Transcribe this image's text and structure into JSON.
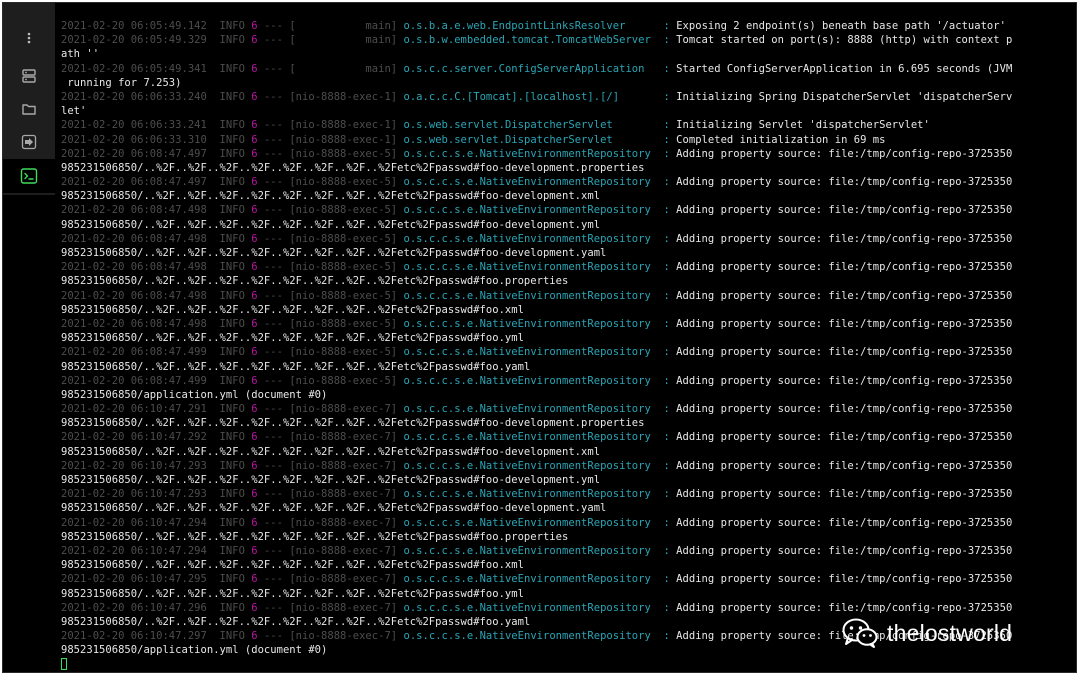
{
  "sidebar": {
    "items": [
      {
        "name": "more-options-icon"
      },
      {
        "name": "server-icon"
      },
      {
        "name": "folder-icon"
      },
      {
        "name": "forward-icon"
      },
      {
        "name": "terminal-icon"
      }
    ]
  },
  "terminal": {
    "lines": [
      "2021-02-20 06:05:49.142  INFO 6 --- [           main] o.s.b.a.e.web.EndpointLinksResolver      : Exposing 2 endpoint(s) beneath base path '/actuator'",
      "2021-02-20 06:05:49.329  INFO 6 --- [           main] o.s.b.w.embedded.tomcat.TomcatWebServer  : Tomcat started on port(s): 8888 (http) with context p",
      "ath ''",
      "2021-02-20 06:05:49.341  INFO 6 --- [           main] o.s.c.c.server.ConfigServerApplication   : Started ConfigServerApplication in 6.695 seconds (JVM",
      " running for 7.253)",
      "2021-02-20 06:06:33.240  INFO 6 --- [nio-8888-exec-1] o.a.c.c.C.[Tomcat].[localhost].[/]       : Initializing Spring DispatcherServlet 'dispatcherServ",
      "let'",
      "2021-02-20 06:06:33.241  INFO 6 --- [nio-8888-exec-1] o.s.web.servlet.DispatcherServlet        : Initializing Servlet 'dispatcherServlet'",
      "2021-02-20 06:06:33.310  INFO 6 --- [nio-8888-exec-1] o.s.web.servlet.DispatcherServlet        : Completed initialization in 69 ms",
      "2021-02-20 06:08:47.497  INFO 6 --- [nio-8888-exec-5] o.s.c.c.s.e.NativeEnvironmentRepository  : Adding property source: file:/tmp/config-repo-3725350",
      "985231506850/..%2F..%2F..%2F..%2F..%2F..%2F..%2F..%2Fetc%2Fpasswd#foo-development.properties",
      "2021-02-20 06:08:47.497  INFO 6 --- [nio-8888-exec-5] o.s.c.c.s.e.NativeEnvironmentRepository  : Adding property source: file:/tmp/config-repo-3725350",
      "985231506850/..%2F..%2F..%2F..%2F..%2F..%2F..%2F..%2Fetc%2Fpasswd#foo-development.xml",
      "2021-02-20 06:08:47.498  INFO 6 --- [nio-8888-exec-5] o.s.c.c.s.e.NativeEnvironmentRepository  : Adding property source: file:/tmp/config-repo-3725350",
      "985231506850/..%2F..%2F..%2F..%2F..%2F..%2F..%2F..%2Fetc%2Fpasswd#foo-development.yml",
      "2021-02-20 06:08:47.498  INFO 6 --- [nio-8888-exec-5] o.s.c.c.s.e.NativeEnvironmentRepository  : Adding property source: file:/tmp/config-repo-3725350",
      "985231506850/..%2F..%2F..%2F..%2F..%2F..%2F..%2F..%2Fetc%2Fpasswd#foo-development.yaml",
      "2021-02-20 06:08:47.498  INFO 6 --- [nio-8888-exec-5] o.s.c.c.s.e.NativeEnvironmentRepository  : Adding property source: file:/tmp/config-repo-3725350",
      "985231506850/..%2F..%2F..%2F..%2F..%2F..%2F..%2F..%2Fetc%2Fpasswd#foo.properties",
      "2021-02-20 06:08:47.498  INFO 6 --- [nio-8888-exec-5] o.s.c.c.s.e.NativeEnvironmentRepository  : Adding property source: file:/tmp/config-repo-3725350",
      "985231506850/..%2F..%2F..%2F..%2F..%2F..%2F..%2F..%2Fetc%2Fpasswd#foo.xml",
      "2021-02-20 06:08:47.498  INFO 6 --- [nio-8888-exec-5] o.s.c.c.s.e.NativeEnvironmentRepository  : Adding property source: file:/tmp/config-repo-3725350",
      "985231506850/..%2F..%2F..%2F..%2F..%2F..%2F..%2F..%2Fetc%2Fpasswd#foo.yml",
      "2021-02-20 06:08:47.499  INFO 6 --- [nio-8888-exec-5] o.s.c.c.s.e.NativeEnvironmentRepository  : Adding property source: file:/tmp/config-repo-3725350",
      "985231506850/..%2F..%2F..%2F..%2F..%2F..%2F..%2F..%2Fetc%2Fpasswd#foo.yaml",
      "2021-02-20 06:08:47.499  INFO 6 --- [nio-8888-exec-5] o.s.c.c.s.e.NativeEnvironmentRepository  : Adding property source: file:/tmp/config-repo-3725350",
      "985231506850/application.yml (document #0)",
      "2021-02-20 06:10:47.291  INFO 6 --- [nio-8888-exec-7] o.s.c.c.s.e.NativeEnvironmentRepository  : Adding property source: file:/tmp/config-repo-3725350",
      "985231506850/..%2F..%2F..%2F..%2F..%2F..%2F..%2F..%2Fetc%2Fpasswd#foo-development.properties",
      "2021-02-20 06:10:47.292  INFO 6 --- [nio-8888-exec-7] o.s.c.c.s.e.NativeEnvironmentRepository  : Adding property source: file:/tmp/config-repo-3725350",
      "985231506850/..%2F..%2F..%2F..%2F..%2F..%2F..%2F..%2Fetc%2Fpasswd#foo-development.xml",
      "2021-02-20 06:10:47.293  INFO 6 --- [nio-8888-exec-7] o.s.c.c.s.e.NativeEnvironmentRepository  : Adding property source: file:/tmp/config-repo-3725350",
      "985231506850/..%2F..%2F..%2F..%2F..%2F..%2F..%2F..%2Fetc%2Fpasswd#foo-development.yml",
      "2021-02-20 06:10:47.293  INFO 6 --- [nio-8888-exec-7] o.s.c.c.s.e.NativeEnvironmentRepository  : Adding property source: file:/tmp/config-repo-3725350",
      "985231506850/..%2F..%2F..%2F..%2F..%2F..%2F..%2F..%2Fetc%2Fpasswd#foo-development.yaml",
      "2021-02-20 06:10:47.294  INFO 6 --- [nio-8888-exec-7] o.s.c.c.s.e.NativeEnvironmentRepository  : Adding property source: file:/tmp/config-repo-3725350",
      "985231506850/..%2F..%2F..%2F..%2F..%2F..%2F..%2F..%2Fetc%2Fpasswd#foo.properties",
      "2021-02-20 06:10:47.294  INFO 6 --- [nio-8888-exec-7] o.s.c.c.s.e.NativeEnvironmentRepository  : Adding property source: file:/tmp/config-repo-3725350",
      "985231506850/..%2F..%2F..%2F..%2F..%2F..%2F..%2F..%2Fetc%2Fpasswd#foo.xml",
      "2021-02-20 06:10:47.295  INFO 6 --- [nio-8888-exec-7] o.s.c.c.s.e.NativeEnvironmentRepository  : Adding property source: file:/tmp/config-repo-3725350",
      "985231506850/..%2F..%2F..%2F..%2F..%2F..%2F..%2F..%2Fetc%2Fpasswd#foo.yml",
      "2021-02-20 06:10:47.296  INFO 6 --- [nio-8888-exec-7] o.s.c.c.s.e.NativeEnvironmentRepository  : Adding property source: file:/tmp/config-repo-3725350",
      "985231506850/..%2F..%2F..%2F..%2F..%2F..%2F..%2F..%2Fetc%2Fpasswd#foo.yaml",
      "2021-02-20 06:10:47.297  INFO 6 --- [nio-8888-exec-7] o.s.c.c.s.e.NativeEnvironmentRepository  : Adding property source: file:/tmp/config-repo-3725350",
      "985231506850/application.yml (document #0)"
    ]
  },
  "watermark": {
    "text": "thelostworld"
  },
  "colors": {
    "background": "#000000",
    "sidebar": "#1e1e1e",
    "dim_text": "#4d4d4d",
    "pid": "#b5179e",
    "logger": "#2aa5b5",
    "message": "#e8e8e8",
    "cursor": "#3ddc5a"
  }
}
